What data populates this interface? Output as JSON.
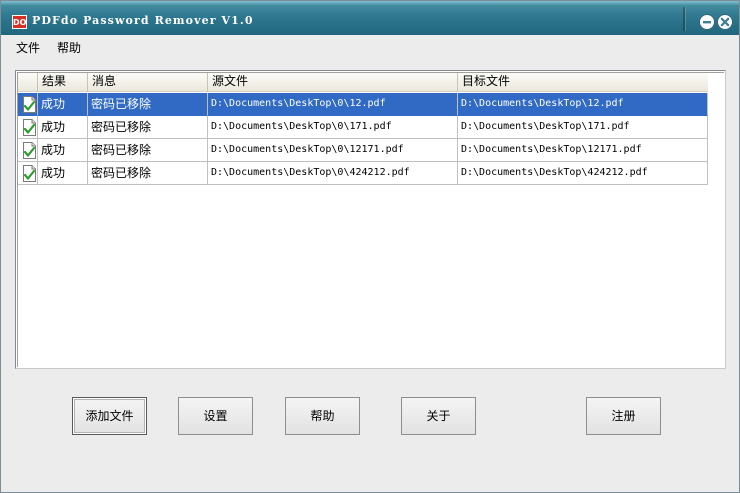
{
  "window": {
    "title": "PDFdo Password Remover V1.0",
    "icon": "pdfdo-logo-icon",
    "icon_text": "DO",
    "accent": "#2e7890"
  },
  "menu": {
    "items": [
      {
        "label": "文件"
      },
      {
        "label": "帮助"
      }
    ]
  },
  "list": {
    "columns": [
      "结果",
      "消息",
      "源文件",
      "目标文件"
    ],
    "rows": [
      {
        "result": "成功",
        "message": "密码已移除",
        "source": "D:\\Documents\\DeskTop\\0\\12.pdf",
        "target": "D:\\Documents\\DeskTop\\12.pdf",
        "selected": true
      },
      {
        "result": "成功",
        "message": "密码已移除",
        "source": "D:\\Documents\\DeskTop\\0\\171.pdf",
        "target": "D:\\Documents\\DeskTop\\171.pdf",
        "selected": false
      },
      {
        "result": "成功",
        "message": "密码已移除",
        "source": "D:\\Documents\\DeskTop\\0\\12171.pdf",
        "target": "D:\\Documents\\DeskTop\\12171.pdf",
        "selected": false
      },
      {
        "result": "成功",
        "message": "密码已移除",
        "source": "D:\\Documents\\DeskTop\\0\\424212.pdf",
        "target": "D:\\Documents\\DeskTop\\424212.pdf",
        "selected": false
      }
    ],
    "selected_color": "#316ac5"
  },
  "buttons": {
    "add_file": "添加文件",
    "settings": "设置",
    "help": "帮助",
    "about": "关于",
    "register": "注册"
  }
}
